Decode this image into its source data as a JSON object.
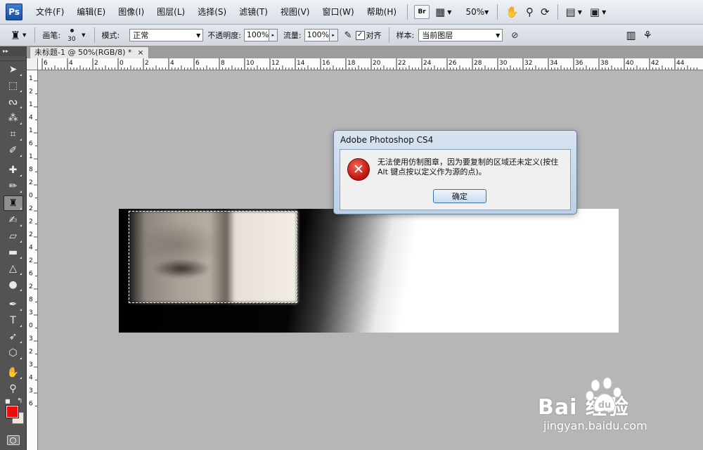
{
  "app": {
    "logo_text": "Ps",
    "menus": [
      "文件(F)",
      "编辑(E)",
      "图像(I)",
      "图层(L)",
      "选择(S)",
      "滤镜(T)",
      "视图(V)",
      "窗口(W)",
      "帮助(H)"
    ],
    "bridge_label": "Br",
    "zoom": "50%"
  },
  "options": {
    "brush_label": "画笔:",
    "brush_size": "30",
    "mode_label": "模式:",
    "mode_value": "正常",
    "opacity_label": "不透明度:",
    "opacity_value": "100%",
    "flow_label": "流量:",
    "flow_value": "100%",
    "align_label": "对齐",
    "align_checked": "✓",
    "sample_label": "样本:",
    "sample_value": "当前图层"
  },
  "document": {
    "collapse_label": "▸▸",
    "tab_title": "未标题-1 @ 50%(RGB/8) *",
    "tab_close": "×"
  },
  "rulers": {
    "horizontal_labels": [
      "6",
      "4",
      "2",
      "0",
      "2",
      "4",
      "6",
      "8",
      "10",
      "12",
      "14",
      "16",
      "18",
      "20",
      "22",
      "24",
      "26",
      "28",
      "30",
      "32",
      "34",
      "36",
      "38",
      "40",
      "42",
      "44"
    ],
    "vertical_labels": [
      "1",
      "2",
      "1",
      "4",
      "1",
      "6",
      "1",
      "8",
      "2",
      "0",
      "2",
      "2",
      "2",
      "4",
      "2",
      "6",
      "2",
      "8",
      "3",
      "0",
      "3",
      "2",
      "3",
      "4",
      "3",
      "6"
    ]
  },
  "colors": {
    "foreground": "#ef0b0b",
    "background": "#f2e7dc"
  },
  "dialog": {
    "title": "Adobe Photoshop CS4",
    "message": "无法使用仿制图章，因为要复制的区域还未定义(按住 Alt 键点按以定义作为源的点)。",
    "ok_label": "确定",
    "icon": "error-icon"
  },
  "watermark": {
    "main": "Bai  经验",
    "sub": "jingyan.baidu.com"
  }
}
